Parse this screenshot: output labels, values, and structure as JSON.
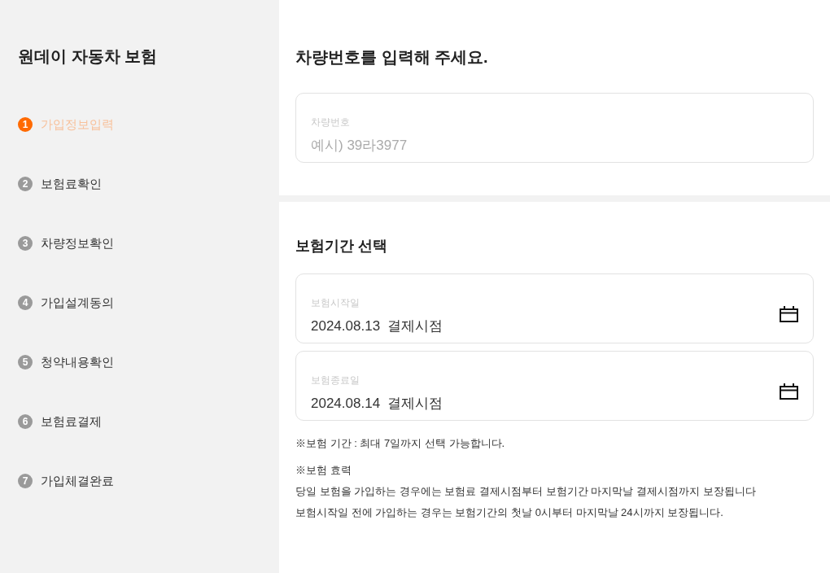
{
  "sidebar": {
    "title": "원데이 자동차 보험",
    "steps": [
      {
        "number": "1",
        "label": "가입정보입력",
        "selected": true
      },
      {
        "number": "2",
        "label": "보험료확인",
        "selected": false
      },
      {
        "number": "3",
        "label": "차량정보확인",
        "selected": false
      },
      {
        "number": "4",
        "label": "가입설계동의",
        "selected": false
      },
      {
        "number": "5",
        "label": "청약내용확인",
        "selected": false
      },
      {
        "number": "6",
        "label": "보험료결제",
        "selected": false
      },
      {
        "number": "7",
        "label": "가입체결완료",
        "selected": false
      }
    ]
  },
  "vehicle_section": {
    "heading": "차량번호를 입력해 주세요.",
    "field": {
      "label": "차량번호",
      "placeholder": "예시) 39라3977"
    }
  },
  "period_section": {
    "heading": "보험기간 선택",
    "fields": [
      {
        "label": "보험시작일",
        "date": "2024.08.13",
        "time": "결제시점"
      },
      {
        "label": "보험종료일",
        "date": "2024.08.14",
        "time": "결제시점"
      }
    ],
    "notes": [
      {
        "lines": [
          "※보험 기간 : 최대 7일까지 선택 가능합니다."
        ]
      },
      {
        "lines": [
          "※보험 효력",
          "당일 보험을 가입하는 경우에는 보험료 결제시점부터 보험기간 마지막날 결제시점까지 보장됩니다",
          "보험시작일 전에 가입하는 경우는 보험기간의 첫날 0시부터 마지막날 24시까지 보장됩니다."
        ]
      }
    ]
  }
}
